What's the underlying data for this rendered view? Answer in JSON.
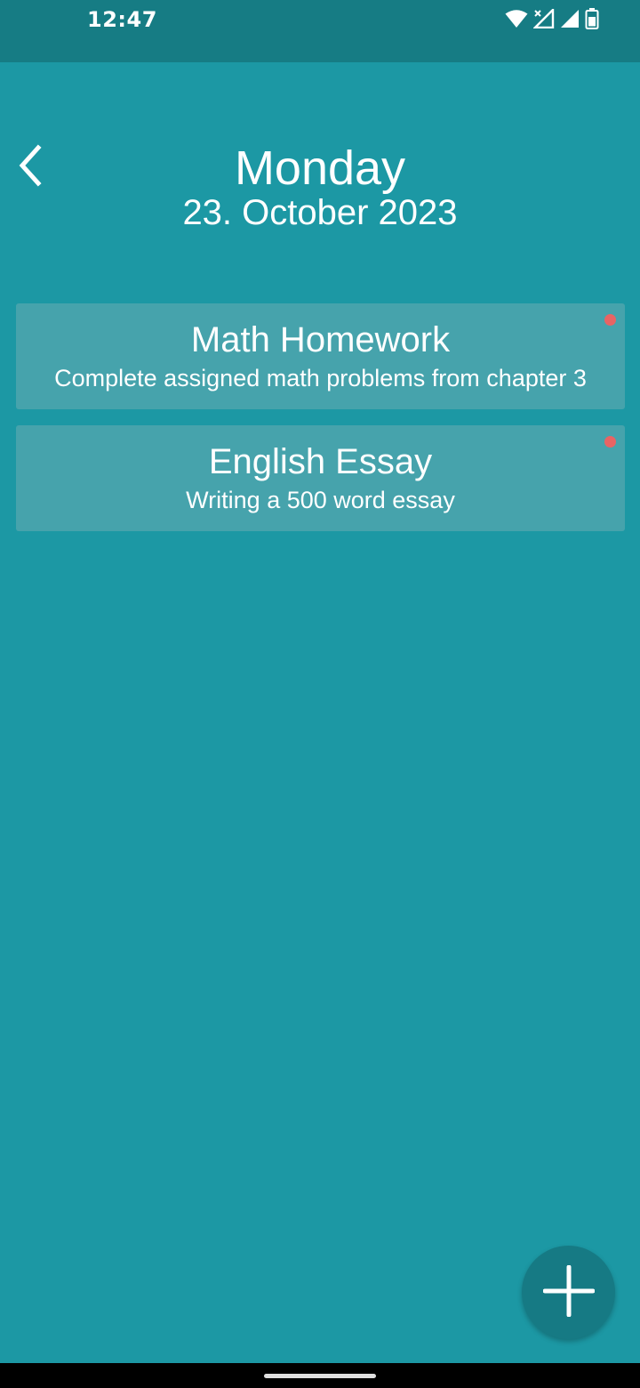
{
  "status_bar": {
    "time": "12:47",
    "icons": [
      "wifi-icon",
      "signal-x-icon",
      "signal-icon",
      "battery-icon"
    ]
  },
  "header": {
    "day": "Monday",
    "date": "23. October 2023"
  },
  "tasks": [
    {
      "title": "Math Homework",
      "description": "Complete assigned math problems from chapter 3",
      "indicator_color": "#e86464"
    },
    {
      "title": "English Essay",
      "description": "Writing a 500 word essay",
      "indicator_color": "#e86464"
    }
  ],
  "colors": {
    "background": "#1c98a4",
    "status_bar": "#167c84",
    "card": "#46a3ac",
    "fab": "#167a84",
    "indicator": "#e86464"
  },
  "actions": {
    "back_icon": "chevron-left-icon",
    "add_icon": "plus-icon"
  }
}
